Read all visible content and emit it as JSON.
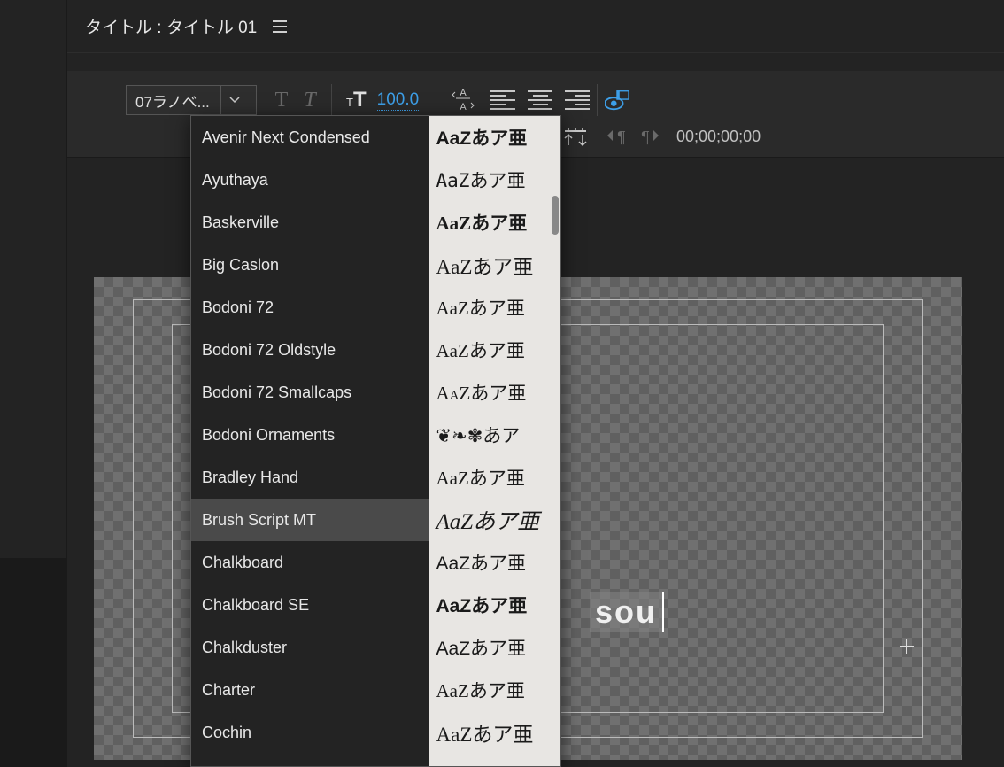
{
  "panel": {
    "title": "タイトル : タイトル 01"
  },
  "toolbar": {
    "font_selected": "07ラノベ...",
    "font_size": "100.0",
    "timecode": "00;00;00;00"
  },
  "canvas": {
    "text": "sou"
  },
  "font_dropdown": {
    "preview_sample": "AaZあア亜",
    "highlighted_index": 9,
    "items": [
      "Avenir Next Condensed",
      "Ayuthaya",
      "Baskerville",
      "Big Caslon",
      "Bodoni 72",
      "Bodoni 72 Oldstyle",
      "Bodoni 72 Smallcaps",
      "Bodoni Ornaments",
      "Bradley Hand",
      "Brush Script MT",
      "Chalkboard",
      "Chalkboard SE",
      "Chalkduster",
      "Charter",
      "Cochin"
    ]
  }
}
